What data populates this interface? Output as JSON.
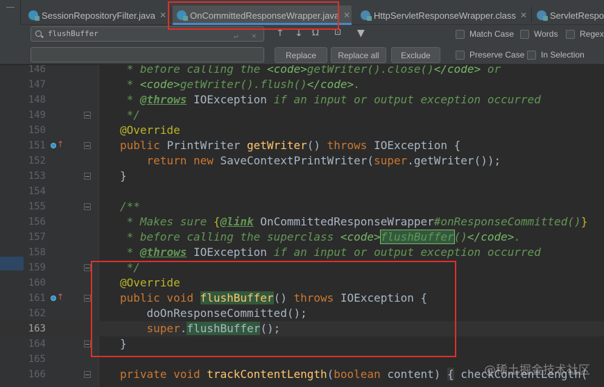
{
  "tabs": [
    {
      "label": "SessionRepositoryFilter.java",
      "icon": "java-class-icon",
      "active": false,
      "closable": true
    },
    {
      "label": "OnCommittedResponseWrapper.java",
      "icon": "java-class-icon",
      "active": true,
      "closable": true
    },
    {
      "label": "HttpServletResponseWrapper.class",
      "icon": "class-file-icon",
      "active": false,
      "closable": true
    },
    {
      "label": "ServletRespon",
      "icon": "class-file-icon",
      "active": false,
      "closable": false
    }
  ],
  "find": {
    "search_value": "flushBuffer",
    "replace_value": "",
    "buttons": {
      "replace": "Replace",
      "replace_all": "Replace all",
      "exclude": "Exclude"
    },
    "options": {
      "match_case": "Match Case",
      "words": "Words",
      "regex": "Regex",
      "preserve_case": "Preserve Case",
      "in_selection": "In Selection"
    },
    "icons": [
      "arrow-up-icon",
      "arrow-down-icon",
      "find-all-icon",
      "select-occurrences-icon",
      "filter-icon"
    ]
  },
  "editor": {
    "current_line": 163,
    "lines": [
      {
        "n": 146,
        "override_icon": false,
        "fold": false
      },
      {
        "n": 147,
        "override_icon": false,
        "fold": false
      },
      {
        "n": 148,
        "override_icon": false,
        "fold": false
      },
      {
        "n": 149,
        "override_icon": false,
        "fold": true
      },
      {
        "n": 150,
        "override_icon": false,
        "fold": false
      },
      {
        "n": 151,
        "override_icon": true,
        "fold": true
      },
      {
        "n": 152,
        "override_icon": false,
        "fold": false
      },
      {
        "n": 153,
        "override_icon": false,
        "fold": true
      },
      {
        "n": 154,
        "override_icon": false,
        "fold": false
      },
      {
        "n": 155,
        "override_icon": false,
        "fold": true
      },
      {
        "n": 156,
        "override_icon": false,
        "fold": false
      },
      {
        "n": 157,
        "override_icon": false,
        "fold": false
      },
      {
        "n": 158,
        "override_icon": false,
        "fold": false
      },
      {
        "n": 159,
        "override_icon": false,
        "fold": true
      },
      {
        "n": 160,
        "override_icon": false,
        "fold": false
      },
      {
        "n": 161,
        "override_icon": true,
        "fold": true
      },
      {
        "n": 162,
        "override_icon": false,
        "fold": false
      },
      {
        "n": 163,
        "override_icon": false,
        "fold": false
      },
      {
        "n": 164,
        "override_icon": false,
        "fold": true
      },
      {
        "n": 165,
        "override_icon": false,
        "fold": false
      },
      {
        "n": 166,
        "override_icon": false,
        "fold": true
      }
    ],
    "code": {
      "l146": {
        "a": " * ",
        "b": "before calling the ",
        "c": "<code>",
        "d": "getWriter().close()",
        "e": "</code>",
        "f": " or"
      },
      "l147": {
        "a": " * ",
        "b": "<code>",
        "c": "getWriter().flush()",
        "d": "</code>",
        "e": "."
      },
      "l148": {
        "a": " * ",
        "b": "@throws",
        "c": " IOException",
        "d": " if an input or output exception occurred"
      },
      "l149": {
        "a": " */"
      },
      "l150": {
        "a": "@Override"
      },
      "l151": {
        "a": "public ",
        "b": "PrintWriter ",
        "c": "getWriter",
        "d": "() ",
        "e": "throws ",
        "f": "IOException {"
      },
      "l152": {
        "a": "    return new ",
        "b": "SaveContextPrintWriter(",
        "c": "super",
        "d": ".getWriter());"
      },
      "l153": {
        "a": "}"
      },
      "l154": {
        "a": ""
      },
      "l155": {
        "a": "/**"
      },
      "l156": {
        "a": " * Makes sure ",
        "b": "{",
        "c": "@link",
        "d": " OnCommittedResponseWrapper",
        "e": "#onResponseCommitted()",
        "f": "}"
      },
      "l157": {
        "a": " * before calling the superclass ",
        "b": "<code>",
        "c": "flushBuffer",
        "d": "()",
        "e": "</code>",
        "f": "."
      },
      "l158": {
        "a": " * ",
        "b": "@throws",
        "c": " IOException",
        "d": " if an input or output exception occurred"
      },
      "l159": {
        "a": " */"
      },
      "l160": {
        "a": "@Override"
      },
      "l161": {
        "a": "public void ",
        "b": "flushBuffer",
        "c": "() ",
        "d": "throws ",
        "e": "IOException {"
      },
      "l162": {
        "a": "    doOnResponseCommitted();"
      },
      "l163": {
        "a": "    super",
        "b": ".",
        "c": "flushBuffer",
        "d": "();"
      },
      "l164": {
        "a": "}"
      },
      "l165": {
        "a": ""
      },
      "l166": {
        "a": "private void ",
        "b": "trackContentLength",
        "c": "(",
        "d": "boolean ",
        "e": "content) ",
        "f": "{",
        "g": " checkContentLength("
      }
    }
  },
  "watermark": "@稀土掘金技术社区",
  "colors": {
    "background": "#2b2b2b",
    "keyword": "#cc7832",
    "doc_comment": "#629755",
    "annotation": "#bbb529",
    "method": "#ffc66d",
    "search_highlight": "#32593d",
    "annotation_box": "#e0302b"
  }
}
